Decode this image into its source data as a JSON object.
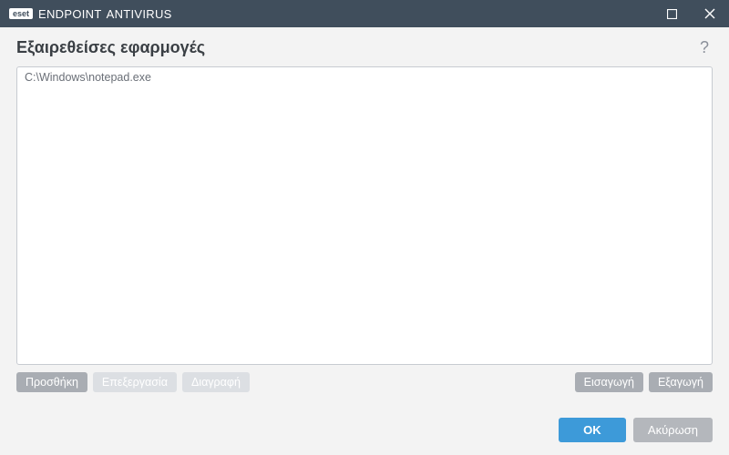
{
  "titlebar": {
    "brand_badge": "eset",
    "brand_endpoint": "ENDPOINT",
    "brand_av": "ANTIVIRUS"
  },
  "header": {
    "title": "Εξαιρεθείσες εφαρμογές",
    "help_symbol": "?"
  },
  "list": {
    "items": [
      {
        "path": "C:\\Windows\\notepad.exe"
      }
    ]
  },
  "toolbar": {
    "add": "Προσθήκη",
    "edit": "Επεξεργασία",
    "delete": "Διαγραφή",
    "import": "Εισαγωγή",
    "export": "Εξαγωγή"
  },
  "footer": {
    "ok": "OK",
    "cancel": "Ακύρωση"
  }
}
